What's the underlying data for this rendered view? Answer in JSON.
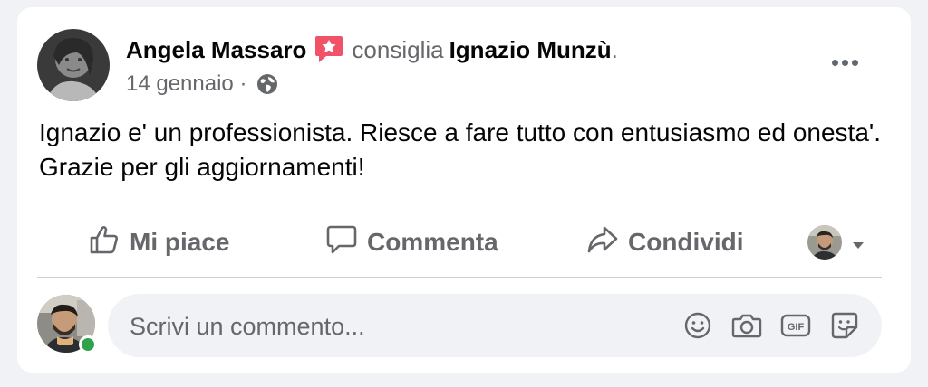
{
  "post": {
    "author": "Angela Massaro",
    "verb": "consiglia",
    "target": "Ignazio Munzù",
    "period": ".",
    "date": "14 gennaio",
    "separator": "·",
    "body": "Ignazio e' un professionista. Riesce a fare tutto con entusiasmo ed onesta'. Grazie per gli aggiornamenti!"
  },
  "actions": {
    "like": "Mi piace",
    "comment": "Commenta",
    "share": "Condividi"
  },
  "composer": {
    "placeholder": "Scrivi un commento...",
    "icons": [
      "smiley-icon",
      "camera-icon",
      "gif-icon",
      "sticker-icon"
    ]
  },
  "colors": {
    "background": "#f0f2f5",
    "secondary_text": "#65676b",
    "online": "#31a24c",
    "recommend_badge": "#f25268"
  }
}
